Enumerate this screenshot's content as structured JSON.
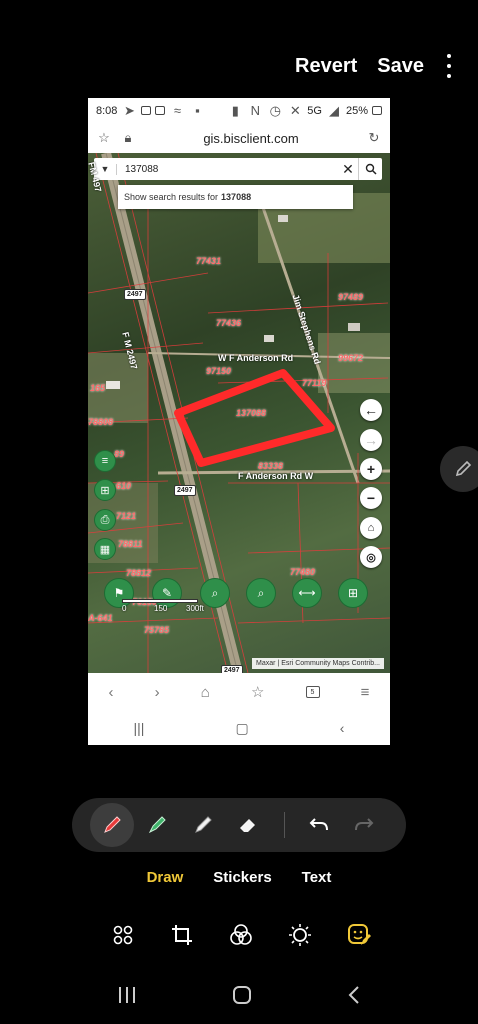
{
  "editor": {
    "revert_label": "Revert",
    "save_label": "Save",
    "modes": [
      "Draw",
      "Stickers",
      "Text"
    ],
    "active_mode": "Draw"
  },
  "screenshot": {
    "status_time": "8:08",
    "status_network": "5G",
    "status_battery": "25%",
    "url": "gis.bisclient.com",
    "search_value": "137088",
    "suggestion_prefix": "Show search results for",
    "suggestion_term": "137088",
    "parcel_labels": [
      "77431",
      "77436",
      "97489",
      "99672",
      "97150",
      "137088",
      "77119",
      "83338",
      "77480",
      "76130",
      "75785",
      "78812",
      "78811",
      "78808",
      "7121",
      "610",
      "165",
      "89",
      "A-641"
    ],
    "road_labels": [
      "F M 2497",
      "Jim Stephens Rd",
      "W F Anderson Rd",
      "F Anderson Rd W",
      "FM 497"
    ],
    "route_shields": [
      "2497",
      "2497",
      "2497"
    ],
    "scale_labels": [
      "0",
      "150",
      "300ft"
    ],
    "attribution": "Maxar | Esri Community Maps Contrib...",
    "tab_count": "5"
  },
  "colors": {
    "accent": "#f0c838",
    "parcel_outline": "#ff2a2a",
    "tool_green": "#2f8f4a"
  }
}
